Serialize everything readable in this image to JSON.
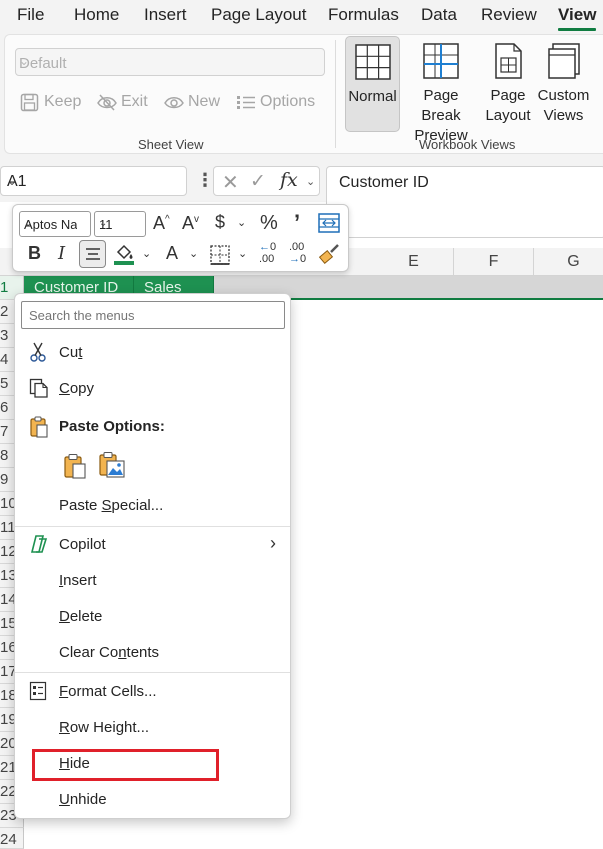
{
  "menu": {
    "tabs": [
      "File",
      "Home",
      "Insert",
      "Page Layout",
      "Formulas",
      "Data",
      "Review",
      "View"
    ],
    "active": "View"
  },
  "ribbon": {
    "sheet_view": {
      "select_value": "Default",
      "keep": "Keep",
      "exit": "Exit",
      "new": "New",
      "options": "Options",
      "group_label": "Sheet View"
    },
    "workbook_views": {
      "normal": "Normal",
      "page_break_line1": "Page Break",
      "page_break_line2": "Preview",
      "page_layout_line1": "Page",
      "page_layout_line2": "Layout",
      "custom_views_line1": "Custom",
      "custom_views_line2": "Views",
      "group_label": "Workbook Views"
    }
  },
  "formula_bar": {
    "name_box": "A1",
    "fx": "fx",
    "content": "Customer ID"
  },
  "mini_toolbar": {
    "font": "Aptos Na",
    "size": "11",
    "bold": "B",
    "italic": "I"
  },
  "grid": {
    "columns": [
      "E",
      "F",
      "G"
    ],
    "rows": [
      "1",
      "2",
      "3",
      "4",
      "5",
      "6",
      "7",
      "8",
      "9",
      "10",
      "11",
      "12",
      "13",
      "14",
      "15",
      "16",
      "17",
      "18",
      "19",
      "20",
      "21",
      "22",
      "23",
      "24"
    ],
    "cells": {
      "a1": "Customer ID",
      "b1": "Sales"
    }
  },
  "context_menu": {
    "search_placeholder": "Search the menus",
    "cut": {
      "pre": "Cu",
      "key": "t",
      "post": ""
    },
    "copy": {
      "pre": "",
      "key": "C",
      "post": "opy"
    },
    "paste_options": "Paste Options:",
    "paste_special": {
      "pre": "Paste ",
      "key": "S",
      "post": "pecial..."
    },
    "copilot": "Copilot",
    "insert": {
      "pre": "",
      "key": "I",
      "post": "nsert"
    },
    "delete": {
      "pre": "",
      "key": "D",
      "post": "elete"
    },
    "clear_contents": {
      "pre": "Clear Co",
      "key": "n",
      "post": "tents"
    },
    "format_cells": {
      "pre": "",
      "key": "F",
      "post": "ormat Cells..."
    },
    "row_height": {
      "pre": "",
      "key": "R",
      "post": "ow Height..."
    },
    "hide": {
      "pre": "",
      "key": "H",
      "post": "ide"
    },
    "unhide": {
      "pre": "",
      "key": "U",
      "post": "nhide"
    }
  },
  "colors": {
    "accent": "#107c41",
    "selected_cell": "#1e9151",
    "highlight_box": "#e0202a"
  }
}
